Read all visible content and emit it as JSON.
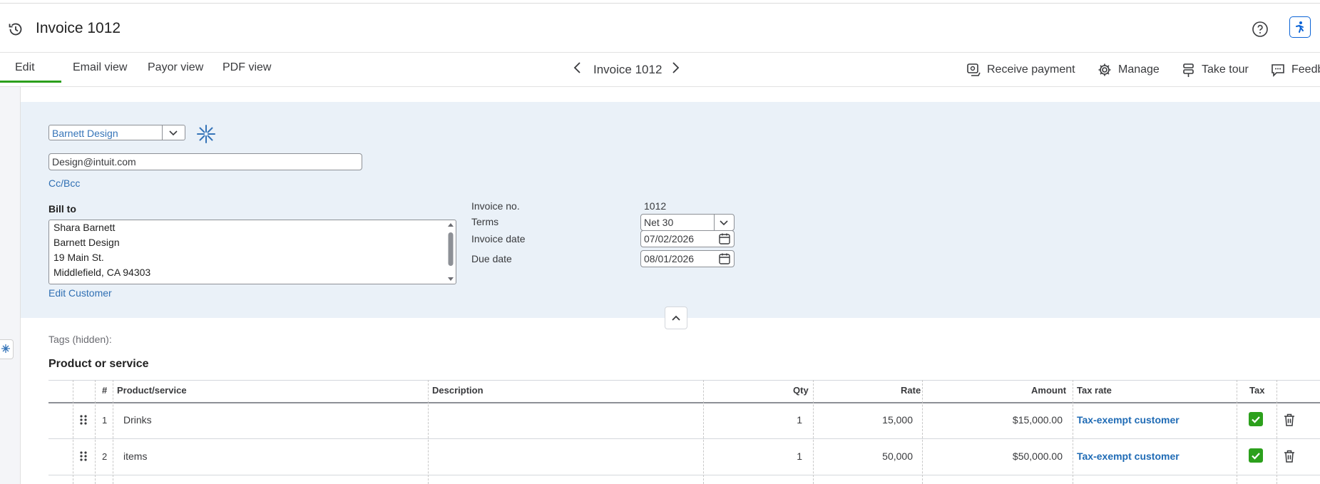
{
  "header": {
    "title": "Invoice 1012"
  },
  "tabs": [
    {
      "label": "Edit"
    },
    {
      "label": "Email view"
    },
    {
      "label": "Payor view"
    },
    {
      "label": "PDF view"
    }
  ],
  "nav": {
    "label": "Invoice 1012"
  },
  "actions": {
    "receive_payment": "Receive payment",
    "manage": "Manage",
    "take_tour": "Take tour",
    "feedback": "Feedb"
  },
  "customer": {
    "name": "Barnett Design",
    "email": "Design@intuit.com",
    "cc_bcc": "Cc/Bcc",
    "bill_to_label": "Bill to",
    "bill_to_lines": [
      "Shara Barnett",
      "Barnett Design",
      "19 Main St.",
      "Middlefield, CA  94303"
    ],
    "edit_customer": "Edit Customer"
  },
  "meta": {
    "invoice_no_label": "Invoice no.",
    "invoice_no": "1012",
    "terms_label": "Terms",
    "terms": "Net 30",
    "invoice_date_label": "Invoice date",
    "invoice_date": "07/02/2026",
    "due_date_label": "Due date",
    "due_date": "08/01/2026"
  },
  "tags": "Tags (hidden):",
  "products": {
    "title": "Product or service",
    "columns": {
      "num": "#",
      "product": "Product/service",
      "description": "Description",
      "qty": "Qty",
      "rate": "Rate",
      "amount": "Amount",
      "tax_rate": "Tax rate",
      "tax": "Tax"
    },
    "rows": [
      {
        "num": "1",
        "product": "Drinks",
        "description": "",
        "qty": "1",
        "rate": "15,000",
        "amount": "$15,000.00",
        "tax_rate": "Tax-exempt customer"
      },
      {
        "num": "2",
        "product": "items",
        "description": "",
        "qty": "1",
        "rate": "50,000",
        "amount": "$50,000.00",
        "tax_rate": "Tax-exempt customer"
      }
    ]
  },
  "colors": {
    "accent_green": "#2ca01c",
    "link_blue": "#2f6fb3",
    "panel_bg": "#eaf1f8",
    "ai_blue": "#0b63d6"
  }
}
